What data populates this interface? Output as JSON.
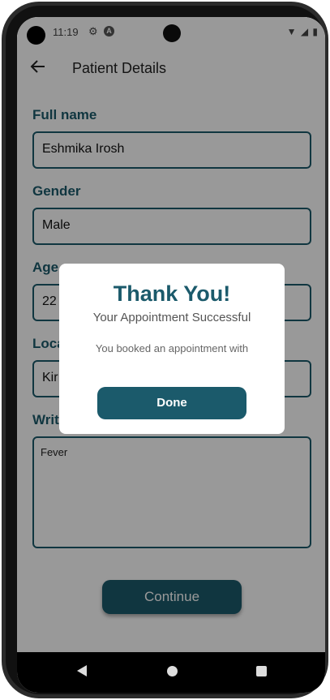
{
  "status_bar": {
    "time": "11:19",
    "icons": [
      "gear-icon",
      "a-icon",
      "wifi-icon",
      "signal-icon",
      "battery-icon"
    ]
  },
  "appbar": {
    "title": "Patient Details"
  },
  "form": {
    "full_name": {
      "label": "Full name",
      "value": "Eshmika Irosh"
    },
    "gender": {
      "label": "Gender",
      "value": "Male"
    },
    "age": {
      "label": "Age",
      "value": "22"
    },
    "location": {
      "label": "Loca",
      "value": "Kir"
    },
    "problem": {
      "label": "Writ",
      "value": "Fever"
    }
  },
  "continue_label": "Continue",
  "dialog": {
    "title": "Thank You!",
    "subtitle": "Your Appointment Successful",
    "body": "You booked an appointment with",
    "done_label": "Done"
  },
  "colors": {
    "accent": "#1b5a6b",
    "scrim": "rgba(0,0,0,0.4)"
  }
}
